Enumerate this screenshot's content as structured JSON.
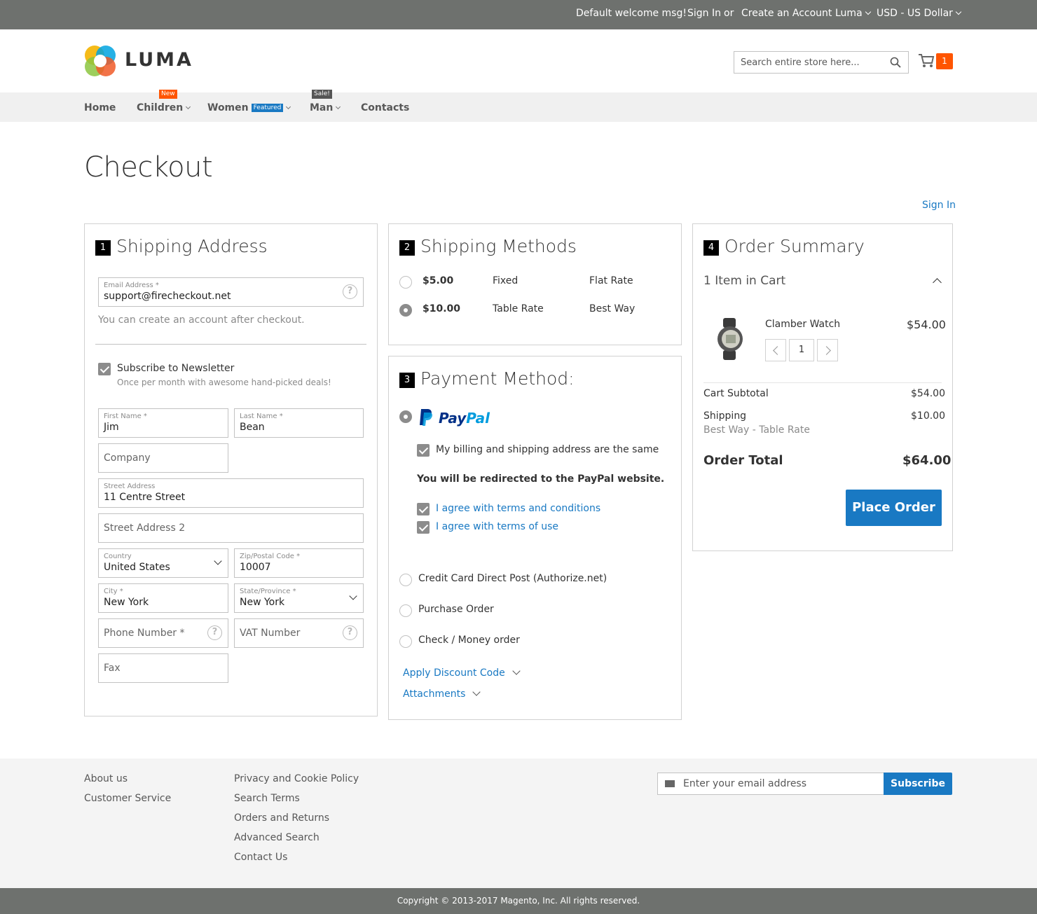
{
  "topbar": {
    "welcome": "Default welcome msg!",
    "sign_in": "Sign In",
    "or": "or",
    "create_account": "Create an Account",
    "store": "Luma",
    "currency": "USD - US Dollar"
  },
  "header": {
    "logo_text": "LUMA",
    "search_placeholder": "Search entire store here...",
    "cart_count": "1"
  },
  "nav": {
    "items": [
      {
        "label": "Home"
      },
      {
        "label": "Children",
        "tag": "New"
      },
      {
        "label": "Women",
        "tag": "Featured"
      },
      {
        "label": "Man",
        "tag": "Sale!"
      },
      {
        "label": "Contacts"
      }
    ]
  },
  "page": {
    "title": "Checkout",
    "sign_in": "Sign In"
  },
  "shipping_address": {
    "step": "1",
    "title": "Shipping Address",
    "email_label": "Email Address *",
    "email_value": "support@firecheckout.net",
    "email_note": "You can create an account after checkout.",
    "newsletter_label": "Subscribe to Newsletter",
    "newsletter_note": "Once per month with awesome hand-picked deals!",
    "first_name_label": "First Name *",
    "first_name": "Jim",
    "last_name_label": "Last Name *",
    "last_name": "Bean",
    "company_placeholder": "Company",
    "street_label": "Street Address",
    "street": "11 Centre Street",
    "street2_placeholder": "Street Address 2",
    "country_label": "Country",
    "country": "United States",
    "zip_label": "Zip/Postal Code *",
    "zip": "10007",
    "city_label": "City *",
    "city": "New York",
    "state_label": "State/Province *",
    "state": "New York",
    "phone_placeholder": "Phone Number *",
    "vat_placeholder": "VAT Number",
    "fax_placeholder": "Fax"
  },
  "shipping_methods": {
    "step": "2",
    "title": "Shipping Methods",
    "options": [
      {
        "price": "$5.00",
        "method": "Fixed",
        "carrier": "Flat Rate",
        "selected": false
      },
      {
        "price": "$10.00",
        "method": "Table Rate",
        "carrier": "Best Way",
        "selected": true
      }
    ]
  },
  "payment": {
    "step": "3",
    "title": "Payment Method:",
    "paypal_label_1": "Pay",
    "paypal_label_2": "Pal",
    "billing_same": "My billing and shipping address are the same",
    "redirect_note": "You will be redirected to the PayPal website.",
    "agree_terms": "I agree with terms and conditions",
    "agree_use": "I agree with terms of use",
    "other_methods": [
      "Credit Card Direct Post (Authorize.net)",
      "Purchase Order",
      "Check / Money order"
    ],
    "discount": "Apply Discount Code",
    "attachments": "Attachments"
  },
  "summary": {
    "step": "4",
    "title": "Order Summary",
    "items_in_cart": "1 Item in Cart",
    "product_name": "Clamber Watch",
    "product_price": "$54.00",
    "qty": "1",
    "subtotal_label": "Cart Subtotal",
    "subtotal": "$54.00",
    "shipping_label": "Shipping",
    "shipping_method": "Best Way - Table Rate",
    "shipping": "$10.00",
    "total_label": "Order Total",
    "total": "$64.00",
    "place_order": "Place Order"
  },
  "footer": {
    "col1": [
      "About us",
      "Customer Service"
    ],
    "col2": [
      "Privacy and Cookie Policy",
      "Search Terms",
      "Orders and Returns",
      "Advanced Search",
      "Contact Us"
    ],
    "newsletter_placeholder": "Enter your email address",
    "subscribe": "Subscribe",
    "copyright": "Copyright © 2013-2017 Magento, Inc. All rights reserved."
  },
  "colors": {
    "accent": "#1979c3",
    "cart_badge": "#ff5501",
    "topbar": "#6e716e"
  }
}
